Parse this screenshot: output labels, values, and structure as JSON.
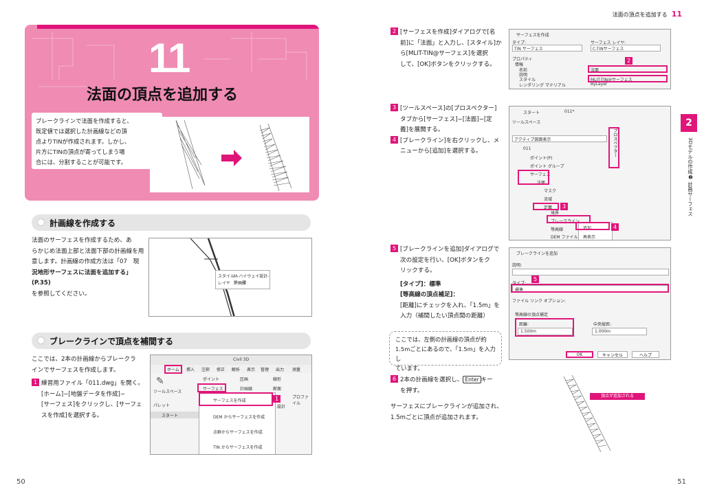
{
  "header": {
    "title": "法面の頂点を追加する",
    "num": "11"
  },
  "hero": {
    "num": "11",
    "title": "法面の頂点を追加する",
    "desc": [
      "ブレークラインで法面を作成すると、",
      "既定値では選択した計画線などの頂",
      "点よりTINが作成されます。しかし、",
      "片方にTINの頂点が寄ってしまう場",
      "合には、分割することが可能です。"
    ]
  },
  "sec1": {
    "title": "計画線を作成する",
    "body": [
      "法面のサーフェスを作成するため、あ",
      "らかじめ法面上部と法面下部の計画線を用",
      "意します。計画線の作成方法は「07　現",
      "況地形サーフェスに法面を追加する」(P.35)",
      "を参照してください。"
    ],
    "pop": [
      "スタイル",
      "レイヤ",
      "M-ハイウェイ設計-テーマ",
      "計画線"
    ]
  },
  "sec2": {
    "title": "ブレークラインで頂点を補間する",
    "intro": [
      "ここでは、2本の計画線からブレークラ",
      "インでサーフェスを作成します。"
    ],
    "step1": [
      "練習用ファイル「011.dwg」を開く。",
      "[ホーム]−[地盤データを作成]−",
      "[サーフェス]をクリックし、[サーフェ",
      "スを作成]を選択する。"
    ]
  },
  "ribbon": {
    "app": "Civil 3D",
    "tabs": [
      "ホーム",
      "挿入",
      "注釈",
      "修正",
      "解析",
      "表示",
      "管理",
      "出力",
      "測量"
    ],
    "left": [
      "ツールスペース",
      "パレット"
    ],
    "groups": [
      "ポイント",
      "サーフェス",
      "区画",
      "計画線",
      "線形",
      "断面",
      "プロファイル",
      "設計"
    ],
    "menu": [
      "サーフェスを作成",
      "DEM からサーフェスを作成",
      "点群からサーフェスを作成",
      "TIN からサーフェスを作成"
    ],
    "start": "スタート"
  },
  "step2": {
    "num": "2",
    "text": [
      "[サーフェスを作成]ダイアログで[名",
      "前]に「法面」と入力し、[スタイル]か",
      "ら[MLIT-TIN@サーフェス]を選択",
      "して、[OK]ボタンをクリックする。"
    ],
    "dialog": {
      "title": "サーフェスを作成",
      "type_label": "タイプ:",
      "type": "TIN サーフェス",
      "layer_label": "サーフェス レイヤ:",
      "layer": "C-TINサーフェス",
      "prop": "プロパティ",
      "info": "情報",
      "name": "名前",
      "name_val": "法面",
      "desc": "説明",
      "style": "スタイル",
      "style_val": "MLIT-TIN@サーフェス",
      "render": "レンダリング マテリアル",
      "render_val": "ByLayer",
      "badge": "2"
    }
  },
  "step3": {
    "num": "3",
    "text": [
      "[ツールスペース]の[プロスペクター]",
      "タブから[サーフェス]−[法面]−[定",
      "義]を展開する。"
    ]
  },
  "step4": {
    "num": "4",
    "text": [
      "[ブレークライン]を右クリックし、メ",
      "ニューから[追加]を選択する。"
    ]
  },
  "tree": {
    "tab1": "スタート",
    "tab2": "011*",
    "panel": "ツールスペース",
    "view": "アクティブ図面表示",
    "vtab": "プロスペクター",
    "items": [
      "011",
      "ポイント(P)",
      "ポイント グループ",
      "サーフェス",
      "法面",
      "マスク",
      "流域",
      "定義",
      "境界",
      "ブレークライン",
      "等高線",
      "DEM ファイル"
    ],
    "ctx": [
      "追加...",
      "再表示"
    ],
    "b3": "3",
    "b4": "4"
  },
  "step5": {
    "num": "5",
    "text": [
      "[ブレークラインを追加]ダイアログで",
      "次の設定を行い、[OK]ボタンをク",
      "リックする。"
    ],
    "detail": [
      "[タイプ]：標準",
      "[等高線の頂点補足]：",
      "[距離]にチェックを入れ、「1.5m」を",
      "入力（補間したい頂点間の距離）"
    ],
    "dialog": {
      "title": "ブレークラインを追加",
      "desc": "説明:",
      "type": "タイプ:",
      "type_val": "標準",
      "file": "ファイル リンク オプション:",
      "group": "等高線の頂点補足",
      "dist": "距離:",
      "dist_val": "1.500m",
      "mid": "中央縦距:",
      "mid_val": "1.000m",
      "ok": "OK",
      "cancel": "キャンセル",
      "help": "ヘルプ",
      "badge": "5"
    }
  },
  "note": [
    "ここでは、左側の計画線の頂点が約",
    "1.5mごとにあるので、「1.5m」を入力し",
    "ています。"
  ],
  "step6": {
    "num": "6",
    "text1": "2本の計画線を選択し、",
    "key": "Enter",
    "text2": "キー",
    "text3": "を押す。",
    "result": [
      "サーフェスにブレークラインが追加され、",
      "1.5mごとに頂点が追加されます。"
    ],
    "label": "頂点が追加される"
  },
  "side": {
    "num": "2",
    "text": "3Dモデルの作成❷ 計画サーフェス"
  },
  "pages": {
    "left": "50",
    "right": "51"
  }
}
